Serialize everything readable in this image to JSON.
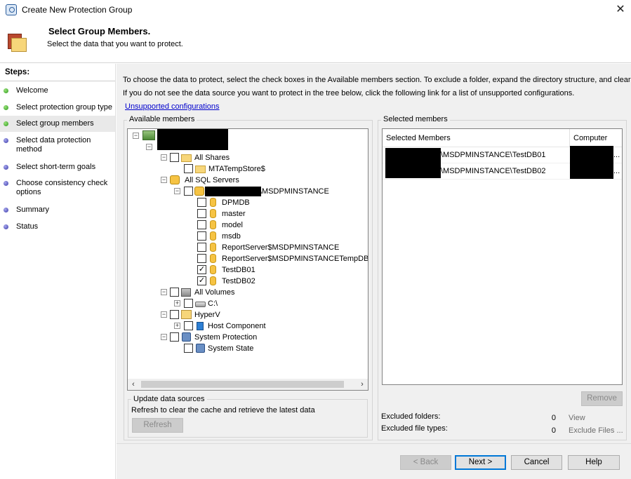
{
  "window": {
    "title": "Create New Protection Group",
    "close_glyph": "✕"
  },
  "header": {
    "title": "Select Group Members.",
    "subtitle": "Select the data that you want to protect."
  },
  "steps": {
    "title": "Steps:",
    "items": [
      {
        "label": "Welcome",
        "status": "completed",
        "color": "#2c9a1e"
      },
      {
        "label": "Select protection group type",
        "status": "completed",
        "color": "#2c9a1e"
      },
      {
        "label": "Select group members",
        "status": "current",
        "color": "#2c9a1e"
      },
      {
        "label": "Select data protection method",
        "status": "pending",
        "color": "#3a3aa8"
      },
      {
        "label": "Select short-term goals",
        "status": "pending",
        "color": "#3a3aa8"
      },
      {
        "label": "Choose consistency check options",
        "status": "pending",
        "color": "#3a3aa8"
      },
      {
        "label": "Summary",
        "status": "pending",
        "color": "#3a3aa8"
      },
      {
        "label": "Status",
        "status": "pending",
        "color": "#3a3aa8"
      }
    ]
  },
  "main": {
    "intro_line1": "To choose the data to protect, select the check boxes in the Available members section. To exclude a folder, expand the directory structure, and clear",
    "intro_line2": "If you do not see the data source you want to protect in the tree below, click the following link for a list of unsupported configurations.",
    "unsupported_link": "Unsupported configurations"
  },
  "available": {
    "label": "Available members",
    "tree": [
      {
        "id": "root",
        "label": "",
        "expander": "minus",
        "checkbox": null,
        "icon": "network-computer-icon",
        "redacted": true
      },
      {
        "id": "shares",
        "label": "All Shares",
        "expander": "minus",
        "checked": false,
        "icon": "shared-folder-icon"
      },
      {
        "id": "mtatempstore",
        "label": "MTATempStore$",
        "expander": null,
        "checked": false,
        "icon": "folder-icon"
      },
      {
        "id": "sql",
        "label": "All SQL Servers",
        "expander": "minus",
        "checkbox": null,
        "icon": "sql-server-icon"
      },
      {
        "id": "instance",
        "label": "\\MSDPMINSTANCE",
        "expander": "minus",
        "checked": false,
        "icon": "sql-instance-icon",
        "redacted": true
      },
      {
        "id": "dpmdb",
        "label": "DPMDB",
        "checked": false,
        "icon": "database-icon"
      },
      {
        "id": "master",
        "label": "master",
        "checked": false,
        "icon": "database-icon"
      },
      {
        "id": "model",
        "label": "model",
        "checked": false,
        "icon": "database-icon"
      },
      {
        "id": "msdb",
        "label": "msdb",
        "checked": false,
        "icon": "database-icon"
      },
      {
        "id": "reportserver",
        "label": "ReportServer$MSDPMINSTANCE",
        "checked": false,
        "icon": "database-icon"
      },
      {
        "id": "reportservertemp",
        "label": "ReportServer$MSDPMINSTANCETempDB",
        "checked": false,
        "icon": "database-icon"
      },
      {
        "id": "testdb01",
        "label": "TestDB01",
        "checked": true,
        "icon": "database-icon"
      },
      {
        "id": "testdb02",
        "label": "TestDB02",
        "checked": true,
        "icon": "database-icon"
      },
      {
        "id": "volumes",
        "label": "All Volumes",
        "expander": "minus",
        "checked": false,
        "icon": "server-icon"
      },
      {
        "id": "cdrive",
        "label": "C:\\",
        "expander": "plus",
        "checked": false,
        "icon": "drive-icon"
      },
      {
        "id": "hyperv",
        "label": "HyperV",
        "expander": "minus",
        "checked": false,
        "icon": "hyperv-icon"
      },
      {
        "id": "hostcomponent",
        "label": "Host Component",
        "expander": "plus",
        "checked": false,
        "icon": "cube-icon"
      },
      {
        "id": "sysprot",
        "label": "System Protection",
        "expander": "minus",
        "checked": false,
        "icon": "system-protection-icon"
      },
      {
        "id": "sysstate",
        "label": "System State",
        "checked": false,
        "icon": "system-state-icon"
      }
    ],
    "scroll_left": "‹",
    "scroll_right": "›"
  },
  "update": {
    "label": "Update data sources",
    "description": "Refresh to clear the cache and retrieve the latest data",
    "refresh_button": "Refresh"
  },
  "selected": {
    "label": "Selected members",
    "columns": [
      "Selected Members",
      "Computer"
    ],
    "rows": [
      {
        "member": "\\MSDPMINSTANCE\\TestDB01",
        "computer": "..."
      },
      {
        "member": "\\MSDPMINSTANCE\\TestDB02",
        "computer": "..."
      }
    ],
    "remove_button": "Remove",
    "excluded_folders_label": "Excluded folders:",
    "excluded_folders_value": "0",
    "excluded_folders_action": "View",
    "excluded_filetypes_label": "Excluded file types:",
    "excluded_filetypes_value": "0",
    "excluded_filetypes_action": "Exclude Files ..."
  },
  "footer": {
    "back": "< Back",
    "next": "Next >",
    "cancel": "Cancel",
    "help": "Help"
  },
  "glyphs": {
    "minus": "−",
    "plus": "+",
    "check": "✓"
  }
}
